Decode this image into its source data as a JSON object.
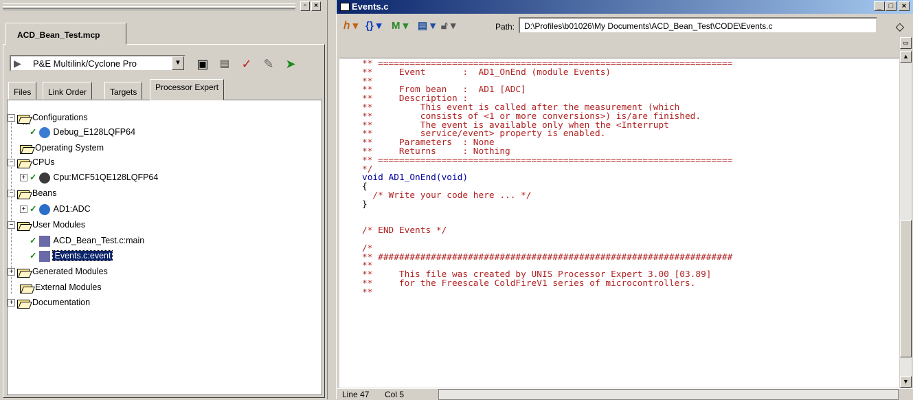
{
  "project_panel": {
    "project_tab": "ACD_Bean_Test.mcp",
    "target": "P&E Multilink/Cyclone Pro",
    "tabs": [
      "Files",
      "Link Order",
      "Targets",
      "Processor Expert"
    ],
    "active_tab": "Processor Expert",
    "tree": {
      "configurations": "Configurations",
      "debug_config": "Debug_E128LQFP64",
      "operating_system": "Operating System",
      "cpus": "CPUs",
      "cpu": "Cpu:MCF51QE128LQFP64",
      "beans": "Beans",
      "ad1": "AD1:ADC",
      "user_modules": "User Modules",
      "main_module": "ACD_Bean_Test.c:main",
      "events_module": "Events.c:event",
      "generated_modules": "Generated Modules",
      "external_modules": "External Modules",
      "documentation": "Documentation"
    }
  },
  "editor": {
    "title": "Events.c",
    "path_label": "Path:",
    "path_value": "D:\\Profiles\\b01026\\My Documents\\ACD_Bean_Test\\CODE\\Events.c",
    "status_line": "Line 47",
    "status_col": "Col 5",
    "code": {
      "l1": "** ===================================================================",
      "l2": "**     Event       :  AD1_OnEnd (module Events)",
      "l3": "**",
      "l4": "**     From bean   :  AD1 [ADC]",
      "l5": "**     Description :",
      "l6": "**         This event is called after the measurement (which",
      "l7": "**         consists of <1 or more conversions>) is/are finished.",
      "l8": "**         The event is available only when the <Interrupt",
      "l9": "**         service/event> property is enabled.",
      "l10": "**     Parameters  : None",
      "l11": "**     Returns     : Nothing",
      "l12": "** ===================================================================",
      "l13": "*/",
      "l14_kw": "void",
      "l14_fn": " AD1_OnEnd(void)",
      "l15": "{",
      "l16": "  /* Write your code here ... */",
      "l17": "}",
      "l18": "",
      "l19": "",
      "l20": "/* END Events */",
      "l21": "",
      "l22": "/*",
      "l23": "** ###################################################################",
      "l24": "**",
      "l25": "**     This file was created by UNIS Processor Expert 3.00 [03.89]",
      "l26": "**     for the Freescale ColdFireV1 series of microcontrollers.",
      "l27": "**"
    }
  },
  "colors": {
    "comment": "#b22222",
    "keyword": "#0000a0",
    "selection": "#0a246a"
  }
}
